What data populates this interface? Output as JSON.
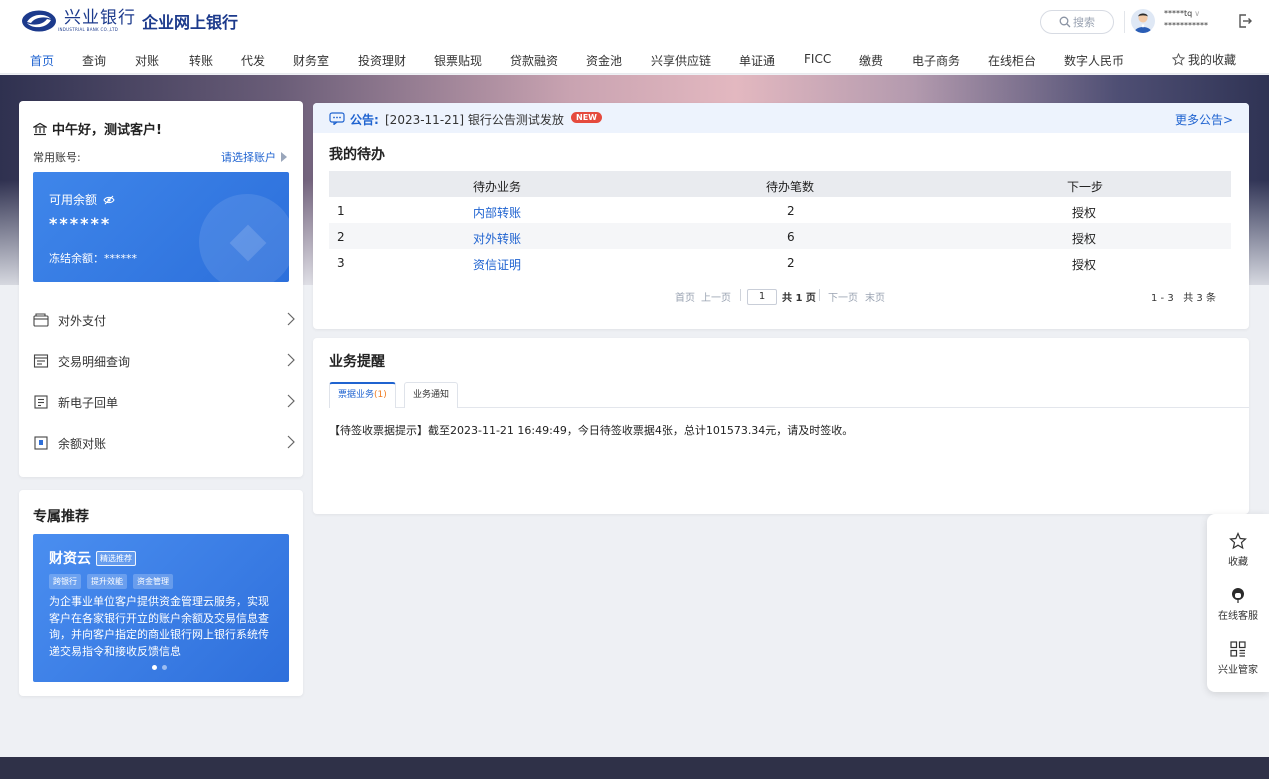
{
  "header": {
    "bank_name": "兴业银行",
    "bank_name_en": "INDUSTRIAL BANK CO.,LTD",
    "product": "企业网上银行",
    "search_placeholder": "搜索",
    "user_name": "*****tq",
    "user_account": "***********"
  },
  "nav": {
    "items": [
      "首页",
      "查询",
      "对账",
      "转账",
      "代发",
      "财务室",
      "投资理财",
      "银票贴现",
      "贷款融资",
      "资金池",
      "兴享供应链",
      "单证通",
      "FICC",
      "缴费",
      "电子商务",
      "在线柜台",
      "数字人民币"
    ],
    "active_index": 0,
    "favorites": "我的收藏"
  },
  "account_card": {
    "greeting": "中午好，测试客户!",
    "common_account_label": "常用账号:",
    "select_account": "请选择账户",
    "available_label": "可用余额",
    "available_value": "******",
    "frozen_label": "冻结余额：******",
    "menu": [
      "对外支付",
      "交易明细查询",
      "新电子回单",
      "余额对账"
    ]
  },
  "recommend": {
    "title": "专属推荐",
    "name": "财资云",
    "badge": "精选推荐",
    "tags": [
      "跨银行",
      "提升效能",
      "资金管理"
    ],
    "desc": "为企事业单位客户提供资金管理云服务，实现客户在各家银行开立的账户余额及交易信息查询，并向客户指定的商业银行网上银行系统传递交易指令和接收反馈信息"
  },
  "notice": {
    "label": "公告:",
    "text": "[2023-11-21] 银行公告测试发放",
    "badge": "NEW",
    "more": "更多公告>"
  },
  "todo": {
    "title": "我的待办",
    "columns": [
      "待办业务",
      "待办笔数",
      "下一步"
    ],
    "rows": [
      {
        "no": "1",
        "biz": "内部转账",
        "count": "2",
        "next": "授权"
      },
      {
        "no": "2",
        "biz": "对外转账",
        "count": "6",
        "next": "授权"
      },
      {
        "no": "3",
        "biz": "资信证明",
        "count": "2",
        "next": "授权"
      }
    ],
    "pager": {
      "first": "首页",
      "prev": "上一页",
      "page": "1",
      "total_pages": "共 1 页",
      "next": "下一页",
      "last": "末页",
      "summary": "1 - 3   共 3 条"
    }
  },
  "reminders": {
    "title": "业务提醒",
    "tab_bill": "票据业务",
    "tab_bill_count": "(1)",
    "tab_notice": "业务通知",
    "text": "【待签收票据提示】截至2023-11-21 16:49:49，今日待签收票据4张，总计101573.34元，请及时签收。"
  },
  "float_tool": {
    "items": [
      "收藏",
      "在线客服",
      "兴业管家"
    ]
  },
  "colors": {
    "primary": "#1f63d0",
    "brand": "#1c3a8c",
    "alert": "#e54a3d"
  }
}
